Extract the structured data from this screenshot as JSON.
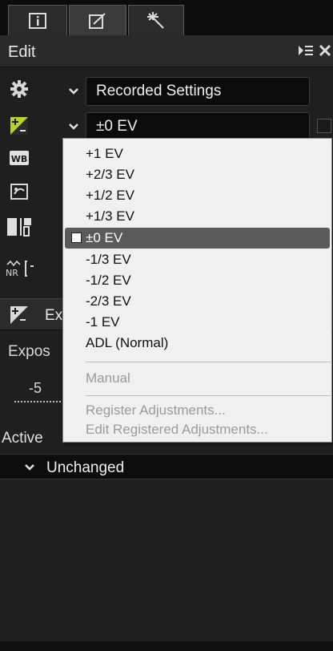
{
  "tabs": [
    {
      "icon": "info-icon"
    },
    {
      "icon": "edit-adjust-icon"
    },
    {
      "icon": "magic-wand-icon"
    }
  ],
  "header": {
    "title": "Edit",
    "menu_icon": "panel-menu-icon",
    "close_icon": "close-icon"
  },
  "sidebar": {
    "icons": [
      "gear-icon",
      "exposure-compensation-icon",
      "white-balance-icon",
      "picture-control-icon",
      "levels-curves-icon",
      "noise-reduction-icon"
    ]
  },
  "rows": {
    "recorded": {
      "value": "Recorded Settings"
    },
    "exposure": {
      "value": "±0 EV"
    }
  },
  "section": {
    "label": "Ex",
    "exposure_label": "Expos",
    "slider_min_label": "-5",
    "active_label": "Active",
    "active_value": "Unchanged"
  },
  "menu": {
    "items": [
      {
        "label": "+1 EV"
      },
      {
        "label": "+2/3 EV"
      },
      {
        "label": "+1/2 EV"
      },
      {
        "label": "+1/3 EV"
      },
      {
        "label": "±0 EV",
        "selected": true
      },
      {
        "label": "-1/3 EV"
      },
      {
        "label": "-1/2 EV"
      },
      {
        "label": "-2/3 EV"
      },
      {
        "label": "-1 EV"
      },
      {
        "label": "ADL (Normal)"
      }
    ],
    "manual": "Manual",
    "register": "Register Adjustments...",
    "edit_registered": "Edit Registered Adjustments..."
  },
  "colors": {
    "panel_bg": "#1f1f1f",
    "menu_bg": "#f0f0f0",
    "menu_selected": "#5b5b5b",
    "exposure_icon": "#b6d230"
  }
}
